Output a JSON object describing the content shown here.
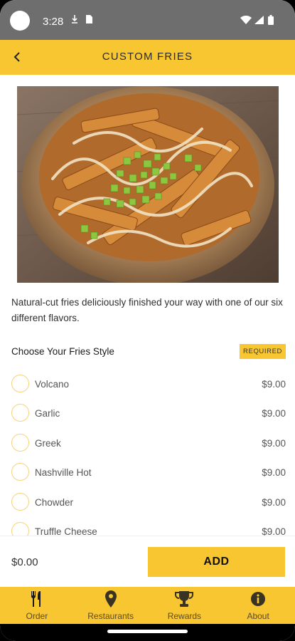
{
  "status_bar": {
    "time": "3:28",
    "icons": [
      "download-icon",
      "sim-card-icon",
      "wifi-icon",
      "cell-signal-icon",
      "battery-icon"
    ]
  },
  "header": {
    "title": "CUSTOM FRIES",
    "back_icon": "chevron-left-icon",
    "background": "#F7C631"
  },
  "item": {
    "image": "fries-bowl-photo",
    "description": "Natural-cut fries deliciously finished your way with one of our six different flavors."
  },
  "section": {
    "title": "Choose Your Fries Style",
    "badge": "REQUIRED"
  },
  "options": [
    {
      "name": "Volcano",
      "price": "$9.00"
    },
    {
      "name": "Garlic",
      "price": "$9.00"
    },
    {
      "name": "Greek",
      "price": "$9.00"
    },
    {
      "name": "Nashville Hot",
      "price": "$9.00"
    },
    {
      "name": "Chowder",
      "price": "$9.00"
    },
    {
      "name": "Truffle Cheese",
      "price": "$9.00"
    }
  ],
  "footer": {
    "total": "$0.00",
    "add_label": "ADD"
  },
  "nav": [
    {
      "label": "Order",
      "icon": "fork-knife-icon"
    },
    {
      "label": "Restaurants",
      "icon": "map-pin-icon"
    },
    {
      "label": "Rewards",
      "icon": "trophy-icon"
    },
    {
      "label": "About",
      "icon": "info-icon"
    }
  ],
  "colors": {
    "accent": "#F7C631",
    "status_bar": "#6e6e6e",
    "radio_border": "#F7D37A"
  }
}
